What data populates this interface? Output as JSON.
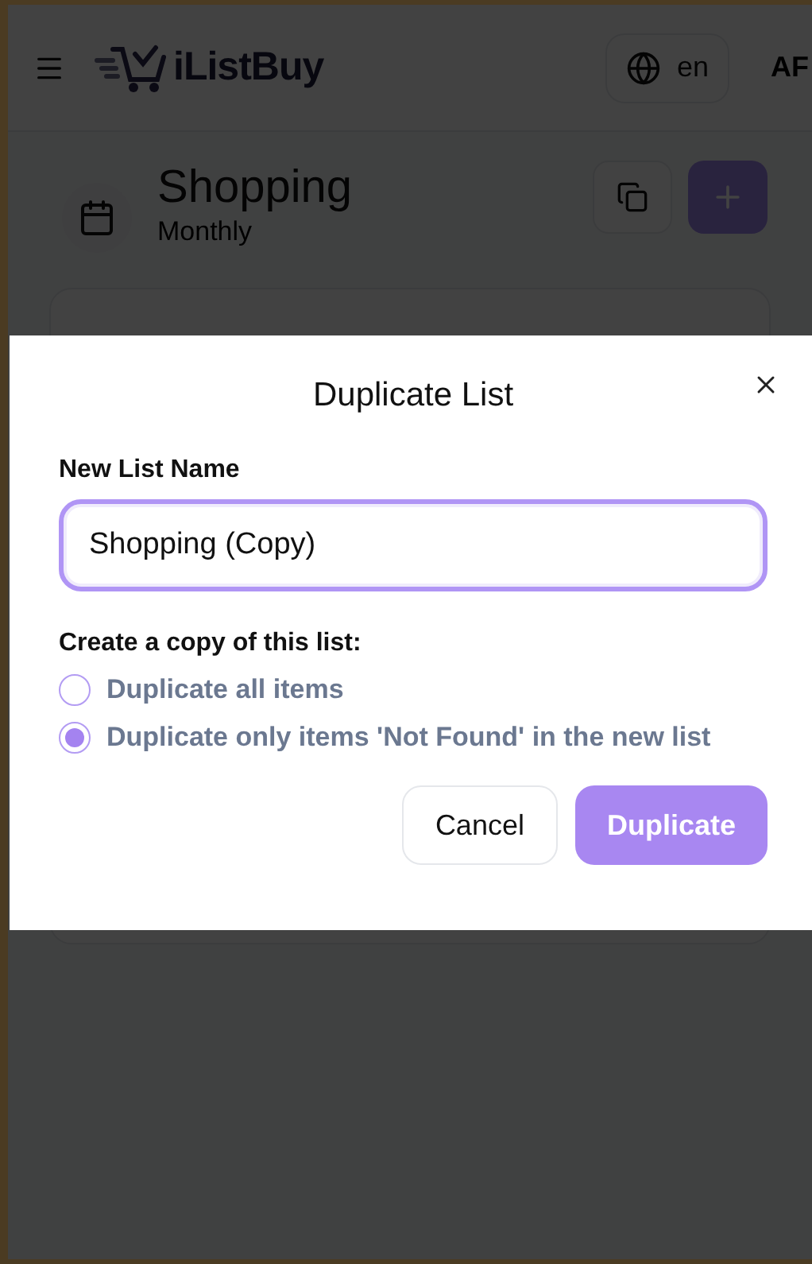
{
  "header": {
    "app_name": "iListBuy",
    "language": "en",
    "avatar": "AF"
  },
  "list": {
    "title": "Shopping",
    "subtitle": "Monthly"
  },
  "dialog": {
    "title": "Duplicate List",
    "field_label": "New List Name",
    "field_value": "Shopping (Copy)",
    "options_label": "Create a copy of this list:",
    "options": [
      {
        "label": "Duplicate all items",
        "selected": false
      },
      {
        "label": "Duplicate only items 'Not Found' in the new list",
        "selected": true
      }
    ],
    "buttons": [
      {
        "label": "Cancel",
        "kind": "secondary"
      },
      {
        "label": "Duplicate",
        "kind": "primary"
      }
    ]
  }
}
